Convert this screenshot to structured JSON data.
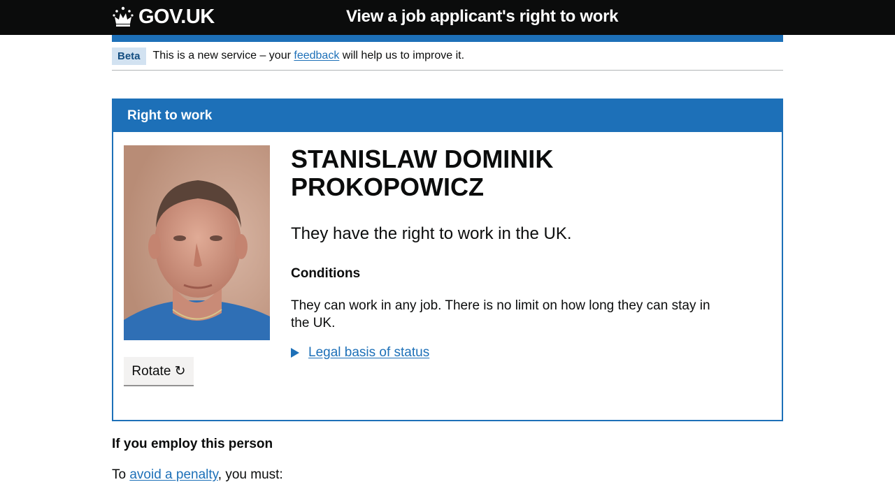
{
  "header": {
    "logo_text": "GOV.UK",
    "service_name": "View a job applicant's right to work"
  },
  "phase_banner": {
    "tag": "Beta",
    "text_before": "This is a new service – your",
    "link": "feedback",
    "text_after": "will help us to improve it."
  },
  "panel": {
    "heading": "Right to work",
    "name": "STANISLAW DOMINIK PROKOPOWICZ",
    "status": "They have the right to work in the UK.",
    "conditions_title": "Conditions",
    "conditions_text": "They can work in any job. There is no limit on how long they can stay in the UK.",
    "details_summary": "Legal basis of status",
    "rotate_label": "Rotate ↻"
  },
  "employ": {
    "title": "If you employ this person",
    "text_before": "To",
    "link": "avoid a penalty",
    "text_after": ", you must:"
  },
  "colors": {
    "header_bg": "#0b0c0c",
    "brand_blue": "#1d70b8",
    "phase_tag_bg": "#d2e2f1"
  }
}
